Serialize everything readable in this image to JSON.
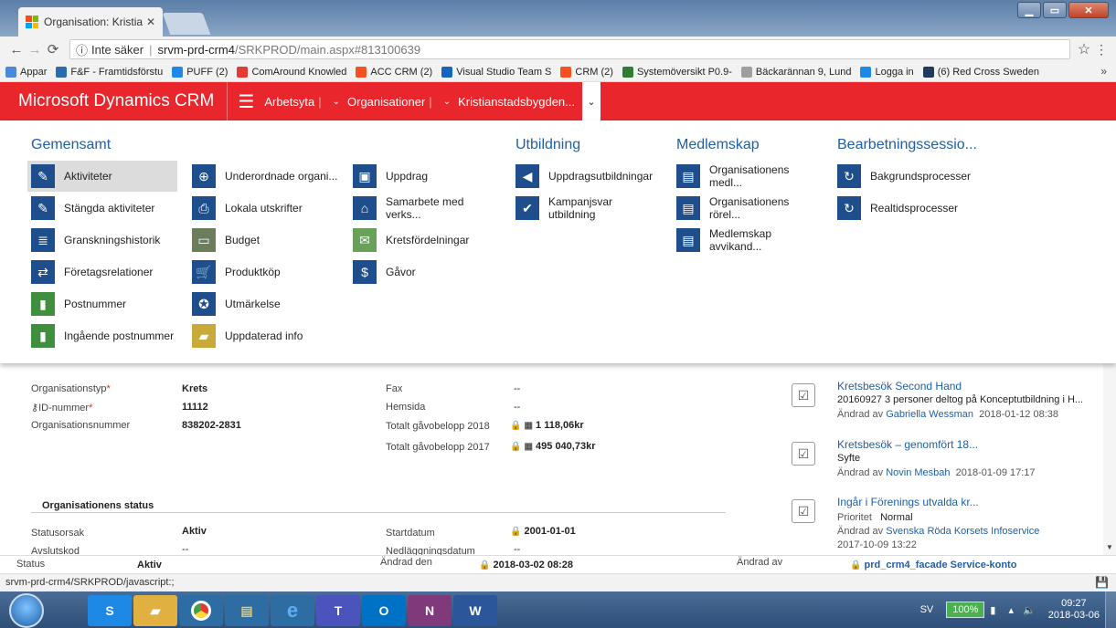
{
  "browser": {
    "tab_title": "Organisation: Kristianstad",
    "secure_label": "Inte säker",
    "url_host": "srvm-prd-crm4",
    "url_path": "/SRKPROD/main.aspx#813100639",
    "bookmarks": [
      {
        "label": "Appar",
        "color": "#4a89dc"
      },
      {
        "label": "F&F - Framtidsförstu",
        "color": "#2b6cb0"
      },
      {
        "label": "PUFF (2)",
        "color": "#1e88e5"
      },
      {
        "label": "ComAround Knowled",
        "color": "#e53935"
      },
      {
        "label": "ACC CRM (2)",
        "color": "#f4511e"
      },
      {
        "label": "Visual Studio Team S",
        "color": "#1565c0"
      },
      {
        "label": "CRM (2)",
        "color": "#f4511e"
      },
      {
        "label": "Systemöversikt P0.9-",
        "color": "#2e7d32"
      },
      {
        "label": "Bäckarännan 9, Lund",
        "color": "#9e9e9e"
      },
      {
        "label": "Logga in",
        "color": "#1e88e5"
      },
      {
        "label": "(6) Red Cross Sweden",
        "color": "#1e3a5f"
      }
    ],
    "more": "»",
    "status_url": "srvm-prd-crm4/SRKPROD/javascript:;"
  },
  "crm": {
    "brand": "Microsoft Dynamics CRM",
    "crumbs": [
      "Arbetsyta",
      "Organisationer",
      "Kristianstadsbygden..."
    ],
    "accent": "#e8262b",
    "groups": [
      {
        "title": "Gemensamt"
      },
      {
        "title": "Utbildning"
      },
      {
        "title": "Medlemskap"
      },
      {
        "title": "Bearbetningssessio..."
      }
    ],
    "items": {
      "c1": [
        "Aktiviteter",
        "Stängda aktiviteter",
        "Granskningshistorik",
        "Företagsrelationer",
        "Postnummer",
        "Ingående postnummer"
      ],
      "c2": [
        "Underordnade organi...",
        "Lokala utskrifter",
        "Budget",
        "Produktköp",
        "Utmärkelse",
        "Uppdaterad info"
      ],
      "c3": [
        "Uppdrag",
        "Samarbete med verks...",
        "Kretsfördelningar",
        "Gåvor"
      ],
      "c4": [
        "Uppdragsutbildningar",
        "Kampanjsvar utbildning"
      ],
      "c5": [
        "Organisationens medl...",
        "Organisationens rörel...",
        "Medlemskap avvikand..."
      ],
      "c6": [
        "Bakgrundsprocesser",
        "Realtidsprocesser"
      ]
    }
  },
  "form": {
    "org_type_label": "Organisationstyp",
    "org_type_value": "Krets",
    "id_label": "ID-nummer",
    "id_value": "11112",
    "orgnr_label": "Organisationsnummer",
    "orgnr_value": "838202-2831",
    "fax_label": "Fax",
    "fax_value": "--",
    "web_label": "Hemsida",
    "web_value": "--",
    "gift2018_label": "Totalt gåvobelopp 2018",
    "gift2018_value": "1 118,06kr",
    "gift2017_label": "Totalt gåvobelopp 2017",
    "gift2017_value": "495 040,73kr",
    "status_section": "Organisationens status",
    "reason_label": "Statusorsak",
    "reason_value": "Aktiv",
    "closecode_label": "Avslutskod",
    "closecode_value": "--",
    "start_label": "Startdatum",
    "start_value": "2001-01-01",
    "shutdown_label": "Nedläggningsdatum",
    "shutdown_value": "--"
  },
  "activities": [
    {
      "title": "Kretsbesök Second Hand",
      "detail": "20160927 3 personer deltog på Konceptutbildning i H...",
      "meta_prefix": "Ändrad av",
      "by": "Gabriella Wessman",
      "when": "2018-01-12 08:38"
    },
    {
      "title": "Kretsbesök – genomfört 18...",
      "detail": "Syfte",
      "meta_prefix": "Ändrad av",
      "by": "Novin Mesbah",
      "when": "2018-01-09 17:17"
    },
    {
      "title": "Ingår i Förenings utvalda kr...",
      "prio_label": "Prioritet",
      "prio_value": "Normal",
      "meta_prefix": "Ändrad av",
      "by": "Svenska Röda Korsets Infoservice",
      "when": "2017-10-09 13:22"
    }
  ],
  "footer": {
    "status_label": "Status",
    "status_value": "Aktiv",
    "changed_label": "Ändrad den",
    "changed_value": "2018-03-02  08:28",
    "changedby_label": "Ändrad av",
    "changedby_value": "prd_crm4_facade Service-konto"
  },
  "taskbar": {
    "lang": "SV",
    "battery": "100%",
    "time": "09:27",
    "date": "2018-03-06"
  }
}
